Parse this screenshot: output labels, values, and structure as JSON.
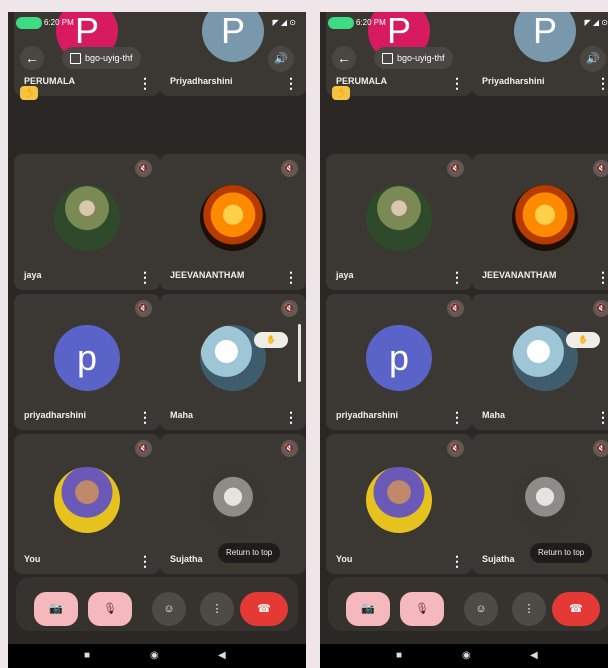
{
  "status": {
    "time": "6:20 PM",
    "sys_icons": "◤ ◢ ⊙"
  },
  "meeting": {
    "code": "bgo-uyig-thf"
  },
  "participants": [
    {
      "name": "PERUMALA",
      "initial": "P",
      "color": "#d81b60",
      "kind": "letter"
    },
    {
      "name": "Priyadharshini",
      "initial": "P",
      "color": "#7a98ab",
      "kind": "letter"
    },
    {
      "name": "jaya",
      "initial": "",
      "color": "",
      "kind": "photo-jaya"
    },
    {
      "name": "JEEVANANTHAM",
      "initial": "",
      "color": "",
      "kind": "photo-jeeva"
    },
    {
      "name": "priyadharshini",
      "initial": "p",
      "color": "#5a63c8",
      "kind": "letter"
    },
    {
      "name": "Maha",
      "initial": "",
      "color": "",
      "kind": "photo-maha"
    },
    {
      "name": "You",
      "initial": "",
      "color": "",
      "kind": "photo-you"
    },
    {
      "name": "Sujatha",
      "initial": "",
      "color": "",
      "kind": "photo-suja"
    }
  ],
  "return_to_top": "Return to top",
  "icons": {
    "back": "←",
    "speaker": "🔊",
    "menu": "⋮",
    "mute": "🔇",
    "camera_off": "📷",
    "mic_off": "🎙",
    "emoji": "☺",
    "more": "⋮",
    "end_call": "☎",
    "hand": "✋",
    "nav_square": "■",
    "nav_circle": "◉",
    "nav_back": "◀"
  },
  "colors": {
    "end_call": "#e53935",
    "toggle_off": "#f4b8bd",
    "hand": "#f6c445"
  }
}
